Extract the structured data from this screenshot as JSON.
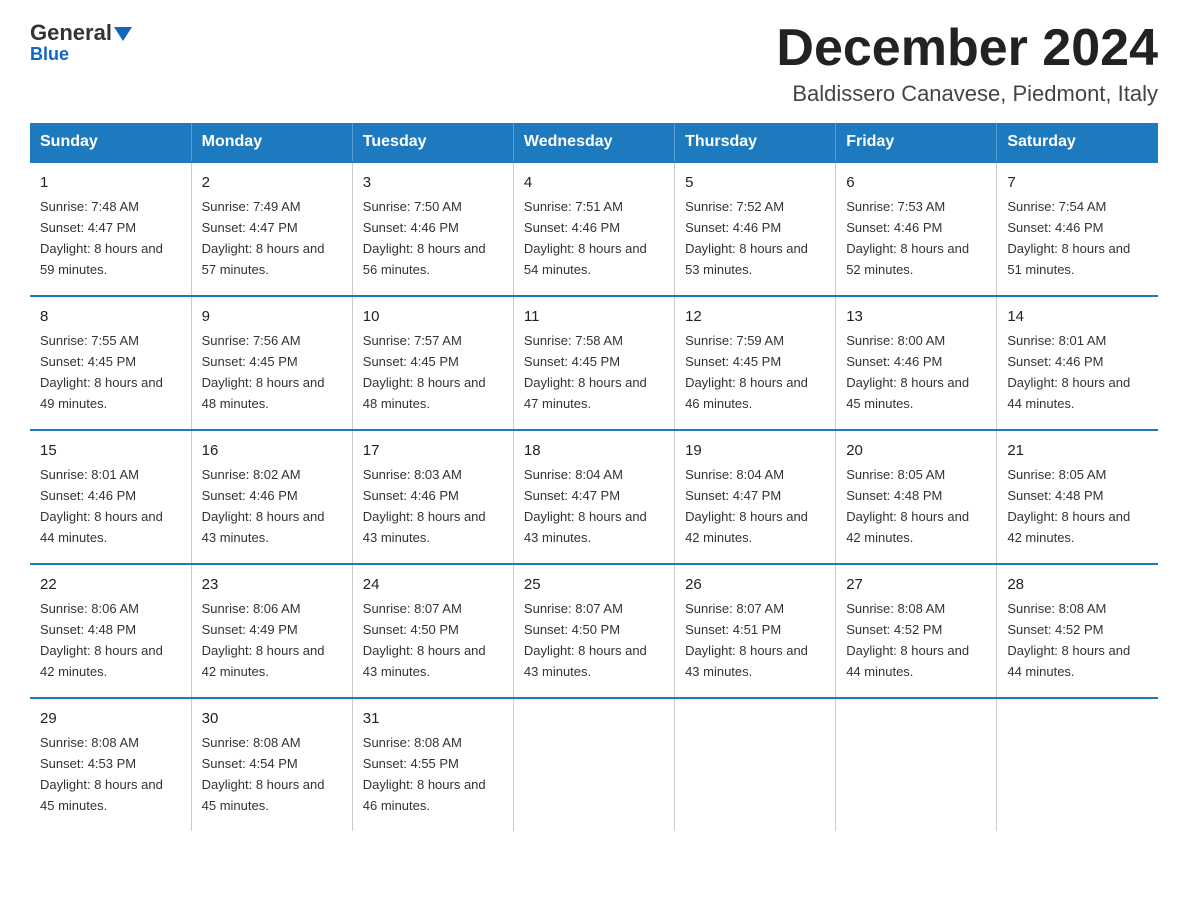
{
  "header": {
    "logo_general": "General",
    "logo_blue": "Blue",
    "month_title": "December 2024",
    "location": "Baldissero Canavese, Piedmont, Italy"
  },
  "weekdays": [
    "Sunday",
    "Monday",
    "Tuesday",
    "Wednesday",
    "Thursday",
    "Friday",
    "Saturday"
  ],
  "weeks": [
    [
      {
        "day": "1",
        "sunrise": "7:48 AM",
        "sunset": "4:47 PM",
        "daylight": "8 hours and 59 minutes."
      },
      {
        "day": "2",
        "sunrise": "7:49 AM",
        "sunset": "4:47 PM",
        "daylight": "8 hours and 57 minutes."
      },
      {
        "day": "3",
        "sunrise": "7:50 AM",
        "sunset": "4:46 PM",
        "daylight": "8 hours and 56 minutes."
      },
      {
        "day": "4",
        "sunrise": "7:51 AM",
        "sunset": "4:46 PM",
        "daylight": "8 hours and 54 minutes."
      },
      {
        "day": "5",
        "sunrise": "7:52 AM",
        "sunset": "4:46 PM",
        "daylight": "8 hours and 53 minutes."
      },
      {
        "day": "6",
        "sunrise": "7:53 AM",
        "sunset": "4:46 PM",
        "daylight": "8 hours and 52 minutes."
      },
      {
        "day": "7",
        "sunrise": "7:54 AM",
        "sunset": "4:46 PM",
        "daylight": "8 hours and 51 minutes."
      }
    ],
    [
      {
        "day": "8",
        "sunrise": "7:55 AM",
        "sunset": "4:45 PM",
        "daylight": "8 hours and 49 minutes."
      },
      {
        "day": "9",
        "sunrise": "7:56 AM",
        "sunset": "4:45 PM",
        "daylight": "8 hours and 48 minutes."
      },
      {
        "day": "10",
        "sunrise": "7:57 AM",
        "sunset": "4:45 PM",
        "daylight": "8 hours and 48 minutes."
      },
      {
        "day": "11",
        "sunrise": "7:58 AM",
        "sunset": "4:45 PM",
        "daylight": "8 hours and 47 minutes."
      },
      {
        "day": "12",
        "sunrise": "7:59 AM",
        "sunset": "4:45 PM",
        "daylight": "8 hours and 46 minutes."
      },
      {
        "day": "13",
        "sunrise": "8:00 AM",
        "sunset": "4:46 PM",
        "daylight": "8 hours and 45 minutes."
      },
      {
        "day": "14",
        "sunrise": "8:01 AM",
        "sunset": "4:46 PM",
        "daylight": "8 hours and 44 minutes."
      }
    ],
    [
      {
        "day": "15",
        "sunrise": "8:01 AM",
        "sunset": "4:46 PM",
        "daylight": "8 hours and 44 minutes."
      },
      {
        "day": "16",
        "sunrise": "8:02 AM",
        "sunset": "4:46 PM",
        "daylight": "8 hours and 43 minutes."
      },
      {
        "day": "17",
        "sunrise": "8:03 AM",
        "sunset": "4:46 PM",
        "daylight": "8 hours and 43 minutes."
      },
      {
        "day": "18",
        "sunrise": "8:04 AM",
        "sunset": "4:47 PM",
        "daylight": "8 hours and 43 minutes."
      },
      {
        "day": "19",
        "sunrise": "8:04 AM",
        "sunset": "4:47 PM",
        "daylight": "8 hours and 42 minutes."
      },
      {
        "day": "20",
        "sunrise": "8:05 AM",
        "sunset": "4:48 PM",
        "daylight": "8 hours and 42 minutes."
      },
      {
        "day": "21",
        "sunrise": "8:05 AM",
        "sunset": "4:48 PM",
        "daylight": "8 hours and 42 minutes."
      }
    ],
    [
      {
        "day": "22",
        "sunrise": "8:06 AM",
        "sunset": "4:48 PM",
        "daylight": "8 hours and 42 minutes."
      },
      {
        "day": "23",
        "sunrise": "8:06 AM",
        "sunset": "4:49 PM",
        "daylight": "8 hours and 42 minutes."
      },
      {
        "day": "24",
        "sunrise": "8:07 AM",
        "sunset": "4:50 PM",
        "daylight": "8 hours and 43 minutes."
      },
      {
        "day": "25",
        "sunrise": "8:07 AM",
        "sunset": "4:50 PM",
        "daylight": "8 hours and 43 minutes."
      },
      {
        "day": "26",
        "sunrise": "8:07 AM",
        "sunset": "4:51 PM",
        "daylight": "8 hours and 43 minutes."
      },
      {
        "day": "27",
        "sunrise": "8:08 AM",
        "sunset": "4:52 PM",
        "daylight": "8 hours and 44 minutes."
      },
      {
        "day": "28",
        "sunrise": "8:08 AM",
        "sunset": "4:52 PM",
        "daylight": "8 hours and 44 minutes."
      }
    ],
    [
      {
        "day": "29",
        "sunrise": "8:08 AM",
        "sunset": "4:53 PM",
        "daylight": "8 hours and 45 minutes."
      },
      {
        "day": "30",
        "sunrise": "8:08 AM",
        "sunset": "4:54 PM",
        "daylight": "8 hours and 45 minutes."
      },
      {
        "day": "31",
        "sunrise": "8:08 AM",
        "sunset": "4:55 PM",
        "daylight": "8 hours and 46 minutes."
      },
      null,
      null,
      null,
      null
    ]
  ]
}
